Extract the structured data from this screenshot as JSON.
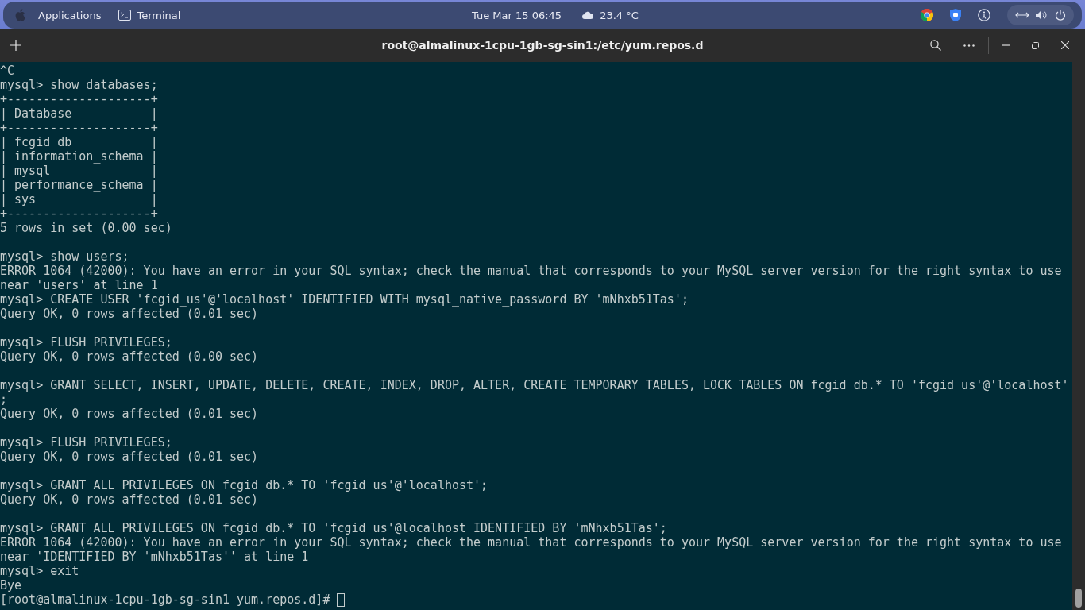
{
  "top_bar": {
    "menu": "Applications",
    "app": "Terminal",
    "datetime": "Tue Mar 15  06:45",
    "weather": "23.4 °C"
  },
  "window": {
    "title": "root@almalinux-1cpu-1gb-sg-sin1:/etc/yum.repos.d"
  },
  "terminal": {
    "lines": [
      {
        "kind": "text",
        "text": "^C"
      },
      {
        "kind": "text",
        "text": "mysql> show databases;"
      },
      {
        "kind": "text",
        "text": "+--------------------+"
      },
      {
        "kind": "text",
        "text": "| Database           |"
      },
      {
        "kind": "text",
        "text": "+--------------------+"
      },
      {
        "kind": "text",
        "text": "| fcgid_db           |"
      },
      {
        "kind": "text",
        "text": "| information_schema |"
      },
      {
        "kind": "text",
        "text": "| mysql              |"
      },
      {
        "kind": "text",
        "text": "| performance_schema |"
      },
      {
        "kind": "text",
        "text": "| sys                |"
      },
      {
        "kind": "text",
        "text": "+--------------------+"
      },
      {
        "kind": "text",
        "text": "5 rows in set (0.00 sec)"
      },
      {
        "kind": "blank"
      },
      {
        "kind": "text",
        "text": "mysql> show users;"
      },
      {
        "kind": "text",
        "text": "ERROR 1064 (42000): You have an error in your SQL syntax; check the manual that corresponds to your MySQL server version for the right syntax to use"
      },
      {
        "kind": "text",
        "text": "near 'users' at line 1"
      },
      {
        "kind": "text",
        "text": "mysql> CREATE USER 'fcgid_us'@'localhost' IDENTIFIED WITH mysql_native_password BY 'mNhxb51Tas';"
      },
      {
        "kind": "text",
        "text": "Query OK, 0 rows affected (0.01 sec)"
      },
      {
        "kind": "blank"
      },
      {
        "kind": "text",
        "text": "mysql> FLUSH PRIVILEGES;"
      },
      {
        "kind": "text",
        "text": "Query OK, 0 rows affected (0.00 sec)"
      },
      {
        "kind": "blank"
      },
      {
        "kind": "text",
        "text": "mysql> GRANT SELECT, INSERT, UPDATE, DELETE, CREATE, INDEX, DROP, ALTER, CREATE TEMPORARY TABLES, LOCK TABLES ON fcgid_db.* TO 'fcgid_us'@'localhost'"
      },
      {
        "kind": "text",
        "text": ";"
      },
      {
        "kind": "text",
        "text": "Query OK, 0 rows affected (0.01 sec)"
      },
      {
        "kind": "blank"
      },
      {
        "kind": "text",
        "text": "mysql> FLUSH PRIVILEGES;"
      },
      {
        "kind": "text",
        "text": "Query OK, 0 rows affected (0.01 sec)"
      },
      {
        "kind": "blank"
      },
      {
        "kind": "text",
        "text": "mysql> GRANT ALL PRIVILEGES ON fcgid_db.* TO 'fcgid_us'@'localhost';"
      },
      {
        "kind": "text",
        "text": "Query OK, 0 rows affected (0.01 sec)"
      },
      {
        "kind": "blank"
      },
      {
        "kind": "text",
        "text": "mysql> GRANT ALL PRIVILEGES ON fcgid_db.* TO 'fcgid_us'@localhost IDENTIFIED BY 'mNhxb51Tas';"
      },
      {
        "kind": "text",
        "text": "ERROR 1064 (42000): You have an error in your SQL syntax; check the manual that corresponds to your MySQL server version for the right syntax to use"
      },
      {
        "kind": "text",
        "text": "near 'IDENTIFIED BY 'mNhxb51Tas'' at line 1"
      },
      {
        "kind": "text",
        "text": "mysql> exit"
      },
      {
        "kind": "text",
        "text": "Bye"
      },
      {
        "kind": "text",
        "text": "[root@almalinux-1cpu-1gb-sg-sin1 yum.repos.d]# "
      }
    ]
  }
}
